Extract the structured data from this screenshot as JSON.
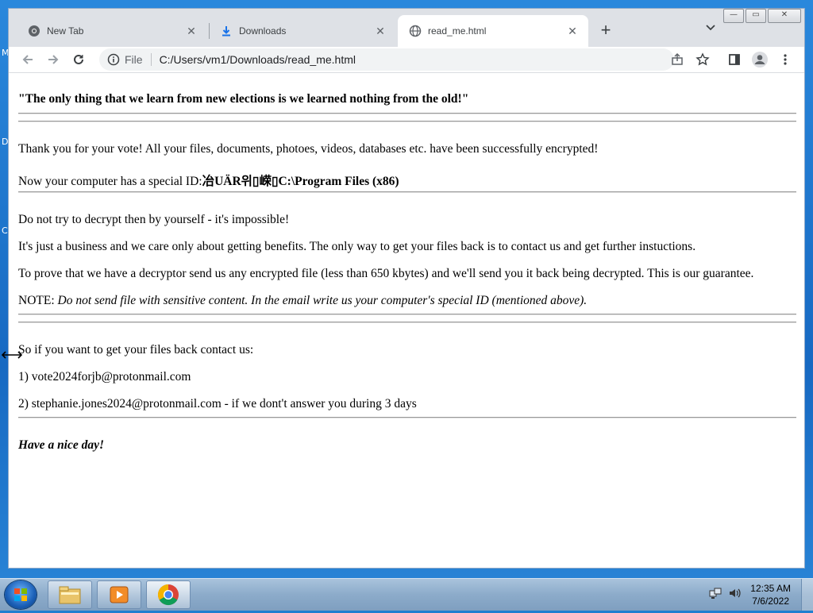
{
  "browser": {
    "tabs": [
      {
        "title": "New Tab",
        "icon": "chrome-icon",
        "active": false
      },
      {
        "title": "Downloads",
        "icon": "download-icon",
        "active": false
      },
      {
        "title": "read_me.html",
        "icon": "globe-icon",
        "active": true
      }
    ],
    "address": {
      "scheme_label": "File",
      "url": "C:/Users/vm1/Downloads/read_me.html"
    },
    "window_controls": {
      "minimize": "—",
      "maximize": "▭",
      "close": "✕"
    }
  },
  "page": {
    "heading": "\"The only thing that we learn from new elections is we learned nothing from the old!\"",
    "line_thanks": "Thank you for your vote! All your files, documents, photoes, videos, databases etc. have been successfully encrypted!",
    "id_prefix": "Now your computer has a special ID:",
    "id_value": "冶UÄR위▯嵘▯C:\\Program Files (x86)",
    "line_no_decrypt": "Do not try to decrypt then by yourself - it's impossible!",
    "line_business": "It's just a business and we care only about getting benefits. The only way to get your files back is to contact us and get further instuctions.",
    "line_prove": "To prove that we have a decryptor send us any encrypted file (less than 650 kbytes) and we'll send you it back being decrypted. This is our guarantee.",
    "note_label": "NOTE: ",
    "note_text": "Do not send file with sensitive content. In the email write us your computer's special ID (mentioned above).",
    "contact_intro": "So if you want to get your files back contact us:",
    "contact_1": "1) vote2024forjb@protonmail.com",
    "contact_2": "2) stephanie.jones2024@protonmail.com - if we dont't answer you during 3 days",
    "closing": "Have a nice day!"
  },
  "taskbar": {
    "apps": [
      "file-explorer-icon",
      "media-player-icon",
      "chrome-icon"
    ],
    "time": "12:35 AM",
    "date": "7/6/2022"
  },
  "colors": {
    "tabstrip": "#dee1e6",
    "taskbar": "#8cabca",
    "desktop": "#1f7fd0"
  }
}
